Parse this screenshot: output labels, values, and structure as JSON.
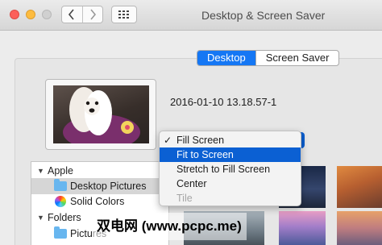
{
  "window": {
    "title": "Desktop & Screen Saver"
  },
  "tabs": [
    {
      "label": "Desktop",
      "selected": true
    },
    {
      "label": "Screen Saver",
      "selected": false
    }
  ],
  "preview": {
    "filename": "2016-01-10 13.18.57-1"
  },
  "fit_menu": {
    "items": [
      {
        "label": "Fill Screen",
        "checked": true,
        "highlighted": false,
        "enabled": true
      },
      {
        "label": "Fit to Screen",
        "checked": false,
        "highlighted": true,
        "enabled": true
      },
      {
        "label": "Stretch to Fill Screen",
        "checked": false,
        "highlighted": false,
        "enabled": true
      },
      {
        "label": "Center",
        "checked": false,
        "highlighted": false,
        "enabled": true
      },
      {
        "label": "Tile",
        "checked": false,
        "highlighted": false,
        "enabled": false
      }
    ],
    "check_mark": "✓"
  },
  "sidebar": {
    "groups": [
      {
        "label": "Apple"
      },
      {
        "label": "Folders"
      }
    ],
    "items": [
      {
        "label": "Desktop Pictures"
      },
      {
        "label": "Solid Colors"
      },
      {
        "label": "Pictures"
      }
    ]
  },
  "watermark": {
    "text": "双电网 (www.pcpc.me)"
  },
  "colors": {
    "accent": "#1577f4",
    "menu_highlight": "#0b60d3"
  },
  "icons": [
    "back-icon",
    "forward-icon",
    "grid-icon",
    "folder-icon",
    "color-wheel-icon",
    "checkmark-icon",
    "disclosure-triangle-icon"
  ]
}
